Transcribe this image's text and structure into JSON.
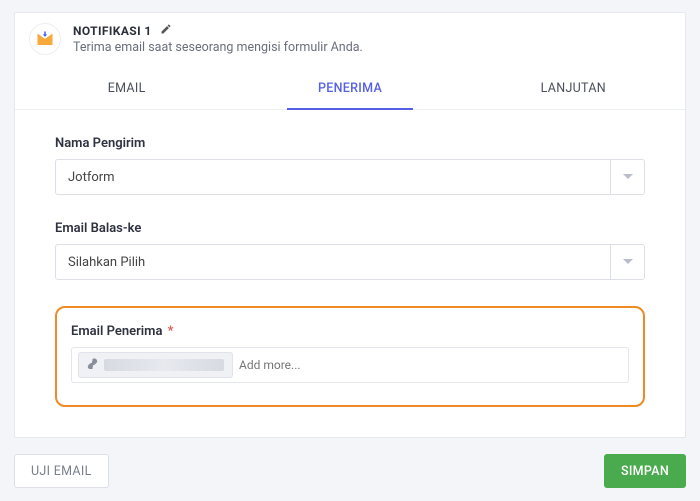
{
  "header": {
    "title": "NOTIFIKASI 1",
    "subtitle": "Terima email saat seseorang mengisi formulir Anda."
  },
  "tabs": {
    "email": "EMAIL",
    "recipients": "PENERIMA",
    "advanced": "LANJUTAN"
  },
  "sender": {
    "label": "Nama Pengirim",
    "value": "Jotform"
  },
  "replyTo": {
    "label": "Email Balas-ke",
    "value": "Silahkan Pilih"
  },
  "recipient": {
    "label": "Email Penerima",
    "required": "*",
    "chip_value": "",
    "add_more": "Add more..."
  },
  "footer": {
    "test": "UJI EMAIL",
    "save": "SIMPAN"
  }
}
